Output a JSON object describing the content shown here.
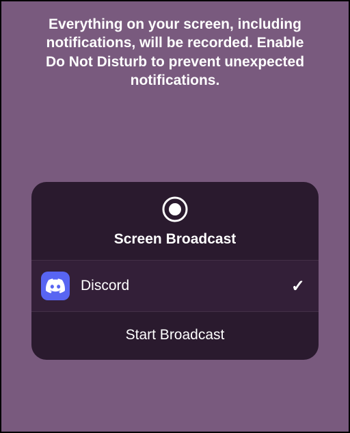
{
  "warning": "Everything on your screen, including notifications, will be recorded. Enable Do Not Disturb to prevent unexpected notifications.",
  "sheet": {
    "title": "Screen Broadcast",
    "app": {
      "name": "Discord",
      "selected": true
    },
    "action_label": "Start Broadcast"
  }
}
